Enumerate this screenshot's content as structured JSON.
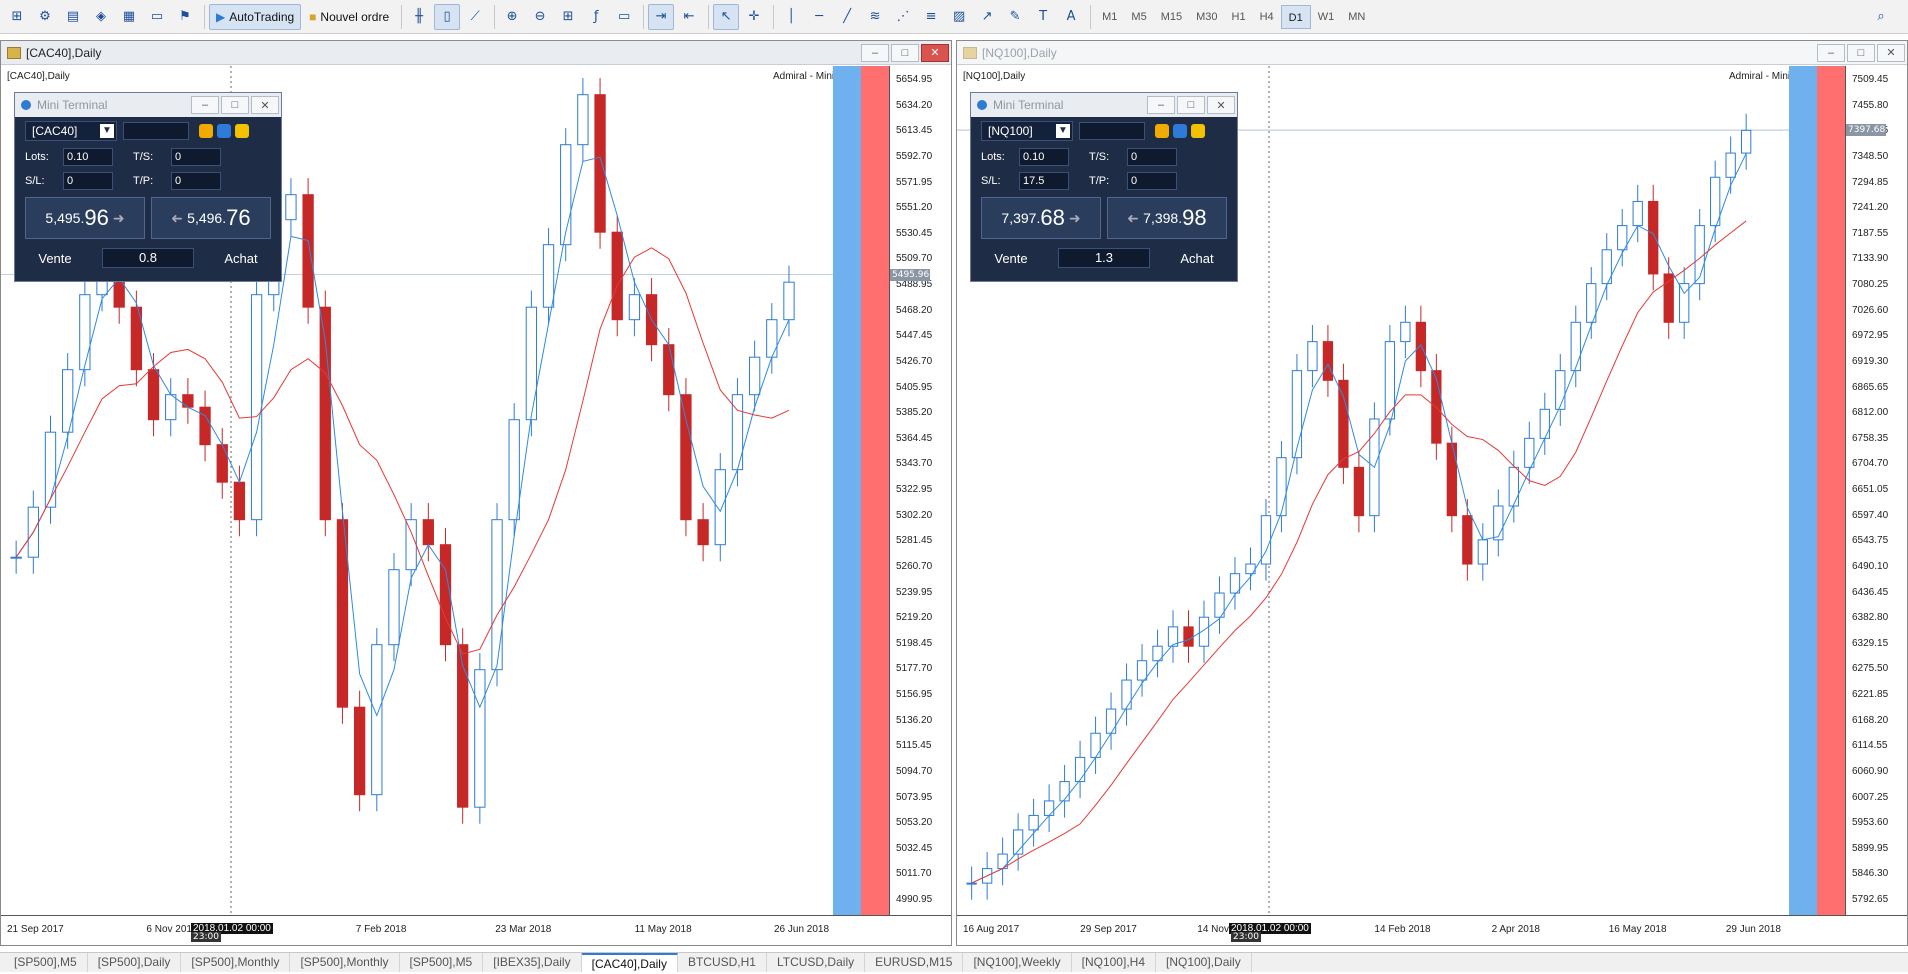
{
  "toolbar": {
    "autotrading": "AutoTrading",
    "new_order": "Nouvel ordre",
    "timeframes": [
      "M1",
      "M5",
      "M15",
      "M30",
      "H1",
      "H4",
      "D1",
      "W1",
      "MN"
    ],
    "active_timeframe": "D1"
  },
  "windows": [
    {
      "title": "[CAC40],Daily",
      "chart_label": "[CAC40],Daily",
      "broker_label": "Admiral - Mini Terminal",
      "price_ticks": [
        "5654.95",
        "5634.20",
        "5613.45",
        "5592.70",
        "5571.95",
        "5551.20",
        "5530.45",
        "5509.70",
        "5488.95",
        "5468.20",
        "5447.45",
        "5426.70",
        "5405.95",
        "5385.20",
        "5364.45",
        "5343.70",
        "5322.95",
        "5302.20",
        "5281.45",
        "5260.70",
        "5239.95",
        "5219.20",
        "5198.45",
        "5177.70",
        "5156.95",
        "5136.20",
        "5115.45",
        "5094.70",
        "5073.95",
        "5053.20",
        "5032.45",
        "5011.70",
        "4990.95"
      ],
      "current_price": "5495.96",
      "dates": [
        "21 Sep 2017",
        "6 Nov 2017",
        "7 Feb 2018",
        "23 Mar 2018",
        "11 May 2018",
        "26 Jun 2018"
      ],
      "date_cursor": "2018.01.02 00:00",
      "time_cursor": "23:00",
      "terminal": {
        "title": "Mini Terminal",
        "symbol": "[CAC40]",
        "lots_label": "Lots:",
        "lots": "0.10",
        "ts_label": "T/S:",
        "ts": "0",
        "sl_label": "S/L:",
        "sl": "0",
        "tp_label": "T/P:",
        "tp": "0",
        "sell_small": "5,495.",
        "sell_big": "96",
        "buy_small": "5,496.",
        "buy_big": "76",
        "sell_label": "Vente",
        "buy_label": "Achat",
        "spread": "0.8"
      },
      "chart_data": {
        "type": "candlestick",
        "ylim": [
          4990.95,
          5654.95
        ],
        "series": [
          {
            "name": "Close",
            "values": [
              5270,
              5310,
              5370,
              5420,
              5480,
              5530,
              5470,
              5420,
              5380,
              5400,
              5390,
              5360,
              5330,
              5300,
              5480,
              5540,
              5560,
              5470,
              5300,
              5150,
              5080,
              5200,
              5260,
              5300,
              5280,
              5200,
              5070,
              5180,
              5300,
              5380,
              5470,
              5520,
              5600,
              5640,
              5530,
              5460,
              5480,
              5440,
              5400,
              5300,
              5280,
              5340,
              5400,
              5430,
              5460,
              5490
            ]
          }
        ]
      }
    },
    {
      "title": "[NQ100],Daily",
      "chart_label": "[NQ100],Daily",
      "broker_label": "Admiral - Mini Terminal",
      "price_ticks": [
        "7509.45",
        "7455.80",
        "7402.15",
        "7348.50",
        "7294.85",
        "7241.20",
        "7187.55",
        "7133.90",
        "7080.25",
        "7026.60",
        "6972.95",
        "6919.30",
        "6865.65",
        "6812.00",
        "6758.35",
        "6704.70",
        "6651.05",
        "6597.40",
        "6543.75",
        "6490.10",
        "6436.45",
        "6382.80",
        "6329.15",
        "6275.50",
        "6221.85",
        "6168.20",
        "6114.55",
        "6060.90",
        "6007.25",
        "5953.60",
        "5899.95",
        "5846.30",
        "5792.65"
      ],
      "current_price": "7397.68",
      "dates": [
        "16 Aug 2017",
        "29 Sep 2017",
        "14 Nov 2017",
        "14 Feb 2018",
        "2 Apr 2018",
        "16 May 2018",
        "29 Jun 2018"
      ],
      "date_cursor": "2018.01.02 00:00",
      "time_cursor": "23:00",
      "terminal": {
        "title": "Mini Terminal",
        "symbol": "[NQ100]",
        "lots_label": "Lots:",
        "lots": "0.10",
        "ts_label": "T/S:",
        "ts": "0",
        "sl_label": "S/L:",
        "sl": "17.5",
        "tp_label": "T/P:",
        "tp": "0",
        "sell_small": "7,397.",
        "sell_big": "68",
        "buy_small": "7,398.",
        "buy_big": "98",
        "sell_label": "Vente",
        "buy_label": "Achat",
        "spread": "1.3"
      },
      "chart_data": {
        "type": "candlestick",
        "ylim": [
          5792.65,
          7509.45
        ],
        "series": [
          {
            "name": "Close",
            "values": [
              5840,
              5870,
              5900,
              5950,
              5980,
              6010,
              6050,
              6100,
              6150,
              6200,
              6260,
              6300,
              6330,
              6370,
              6330,
              6390,
              6440,
              6480,
              6500,
              6600,
              6720,
              6900,
              6960,
              6880,
              6700,
              6600,
              6800,
              6960,
              7000,
              6900,
              6750,
              6600,
              6500,
              6550,
              6620,
              6700,
              6760,
              6820,
              6900,
              7000,
              7080,
              7150,
              7200,
              7250,
              7100,
              7000,
              7080,
              7200,
              7300,
              7350,
              7397
            ]
          }
        ]
      }
    }
  ],
  "tabs": [
    "[SP500],M5",
    "[SP500],Daily",
    "[SP500],Monthly",
    "[SP500],Monthly",
    "[SP500],M5",
    "[IBEX35],Daily",
    "[CAC40],Daily",
    "BTCUSD,H1",
    "LTCUSD,Daily",
    "EURUSD,M15",
    "[NQ100],Weekly",
    "[NQ100],H4",
    "[NQ100],Daily"
  ],
  "active_tab": "[CAC40],Daily"
}
